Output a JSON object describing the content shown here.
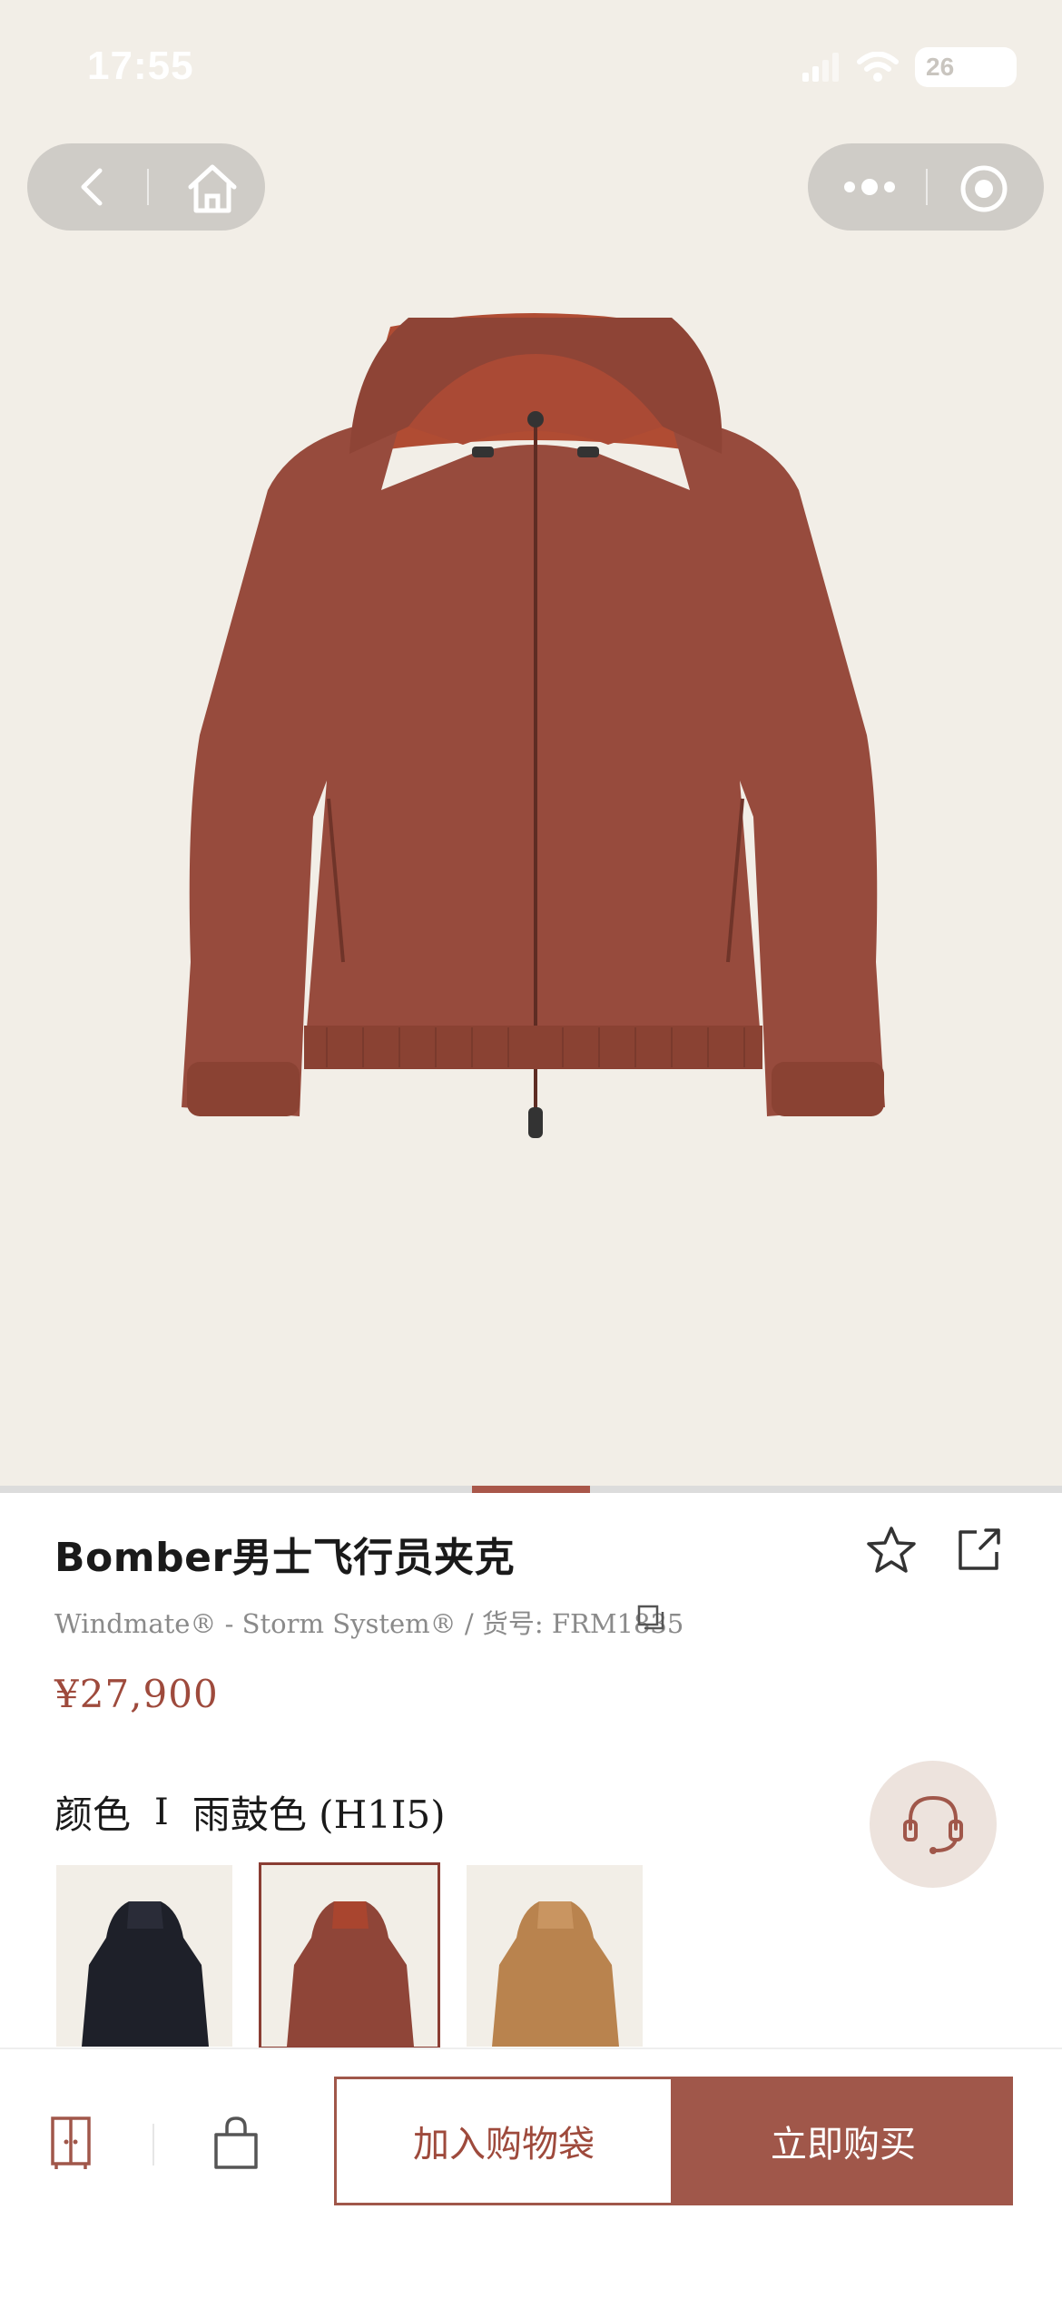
{
  "status_bar": {
    "time": "17:55",
    "battery": "26"
  },
  "product": {
    "title": "Bomber男士飞行员夹克",
    "subtitle": "Windmate® - Storm System® / 货号: FRM1835",
    "price": "¥27,900",
    "color_label": "颜色",
    "color_separator": "I",
    "color_value": "雨鼓色 (H1I5)"
  },
  "gallery": {
    "progress_fraction": 0.5
  },
  "swatches": [
    {
      "color": "#1e2029",
      "selected": false
    },
    {
      "color": "#8f4538",
      "selected": true
    },
    {
      "color": "#b9834e",
      "selected": false
    }
  ],
  "actions": {
    "add_to_bag": "加入购物袋",
    "buy_now": "立即购买"
  },
  "colors": {
    "accent": "#a0574a",
    "hero_bg": "#f2eee7",
    "jacket": "#974b3d"
  }
}
